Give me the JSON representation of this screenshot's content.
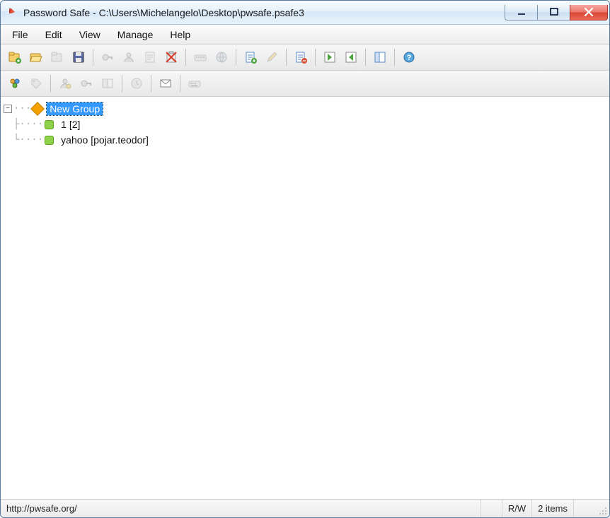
{
  "window": {
    "title": "Password Safe - C:\\Users\\Michelangelo\\Desktop\\pwsafe.psafe3"
  },
  "menu": {
    "items": [
      "File",
      "Edit",
      "View",
      "Manage",
      "Help"
    ]
  },
  "toolbar_row1": {
    "icons": [
      "new-db-icon",
      "open-db-icon",
      "close-db-icon",
      "save-db-icon",
      "sep",
      "copy-password-icon",
      "copy-username-icon",
      "copy-notes-icon",
      "clear-clipboard-icon",
      "sep",
      "autotype-icon",
      "browse-url-icon",
      "sep",
      "add-entry-icon",
      "edit-entry-icon",
      "sep",
      "delete-entry-icon",
      "sep",
      "expand-icon",
      "collapse-icon",
      "sep",
      "options-icon",
      "sep",
      "help-icon"
    ]
  },
  "toolbar_row2": {
    "icons": [
      "manage-filters-icon",
      "tag-icon",
      "sep",
      "password-policy-icon",
      "generate-password-icon",
      "compare-icon",
      "sep",
      "backup-icon",
      "sep",
      "email-icon",
      "sep",
      "keyboard-icon"
    ]
  },
  "tree": {
    "group": {
      "label": "New Group",
      "expanded": true,
      "entries": [
        {
          "label": "1 [2]"
        },
        {
          "label": "yahoo [pojar.teodor]"
        }
      ]
    }
  },
  "statusbar": {
    "url": "http://pwsafe.org/",
    "rw": "R/W",
    "count": "2 items"
  }
}
